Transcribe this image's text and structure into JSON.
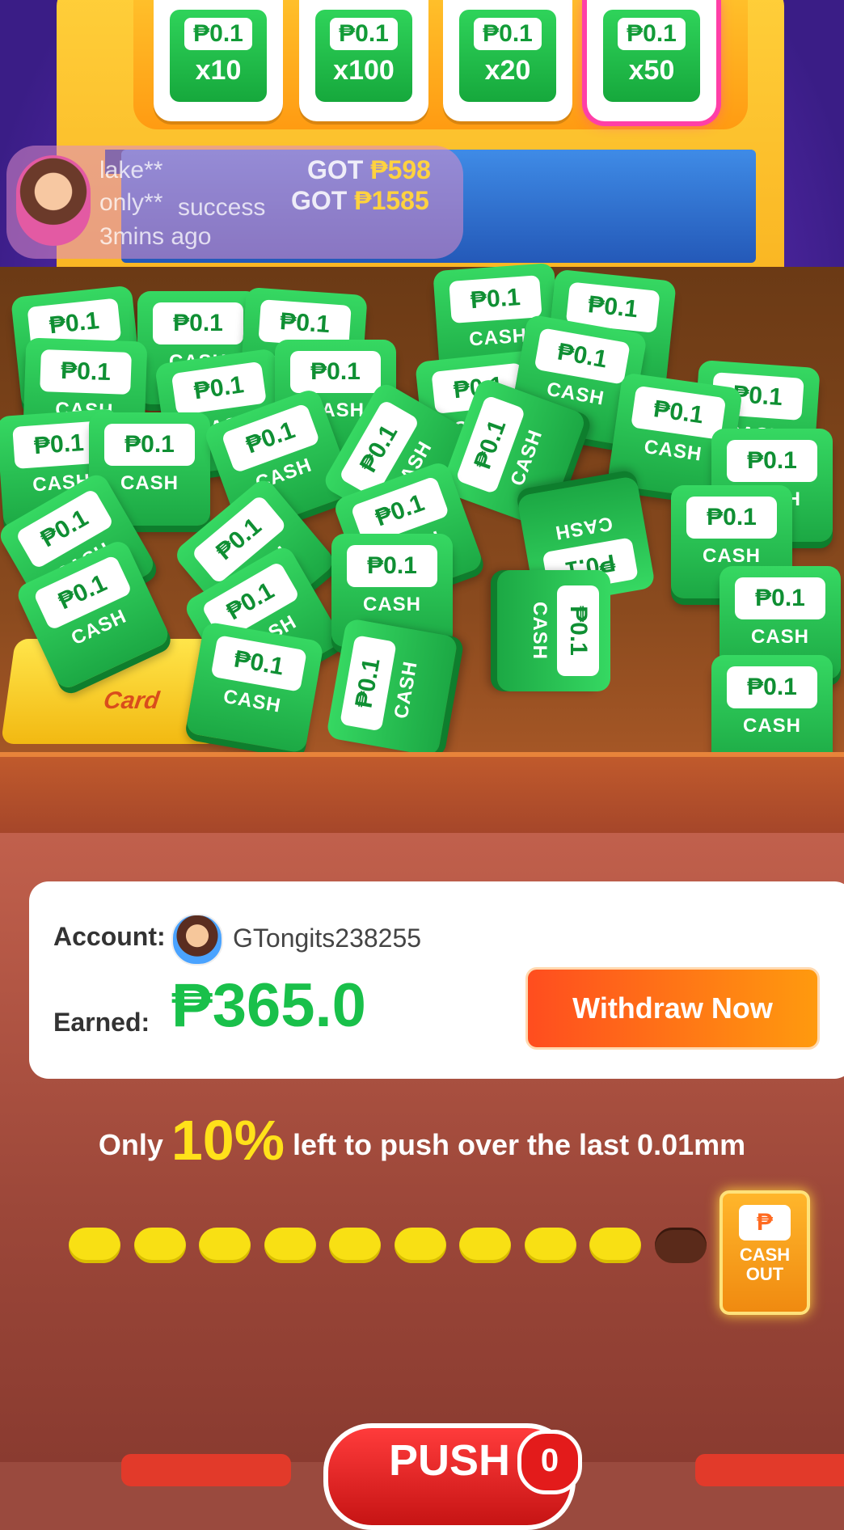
{
  "bets": [
    {
      "value": "₱0.1",
      "multiplier": "x10",
      "selected": false
    },
    {
      "value": "₱0.1",
      "multiplier": "x100",
      "selected": false
    },
    {
      "value": "₱0.1",
      "multiplier": "x20",
      "selected": false
    },
    {
      "value": "₱0.1",
      "multiplier": "x50",
      "selected": true
    }
  ],
  "ticker": {
    "line1_user": "lake**",
    "line1_got": "GOT",
    "line1_amount": "₱598",
    "line2_user": "only**",
    "line2_got": "GOT",
    "line2_amount": "₱1585",
    "line3": "success",
    "line4": "3mins ago"
  },
  "coin": {
    "value": "₱0.1",
    "label": "CASH"
  },
  "gold_card_label": "Card",
  "account": {
    "account_label": "Account:",
    "username": "GTongits238255",
    "earned_label": "Earned:",
    "earned_value": "₱365.0",
    "withdraw_label": "Withdraw Now"
  },
  "progress": {
    "prefix": "Only",
    "percent": "10%",
    "suffix": "left to push over the last 0.01mm",
    "filled_dots": 9,
    "total_dots": 10
  },
  "cashout": {
    "icon": "₱",
    "line1": "CASH",
    "line2": "OUT"
  },
  "push": {
    "label": "PUSH",
    "badge": "0"
  },
  "colors": {
    "accent_green": "#19c04a",
    "withdraw_orange": "#ff6a1a",
    "progress_yellow": "#f8e014"
  }
}
